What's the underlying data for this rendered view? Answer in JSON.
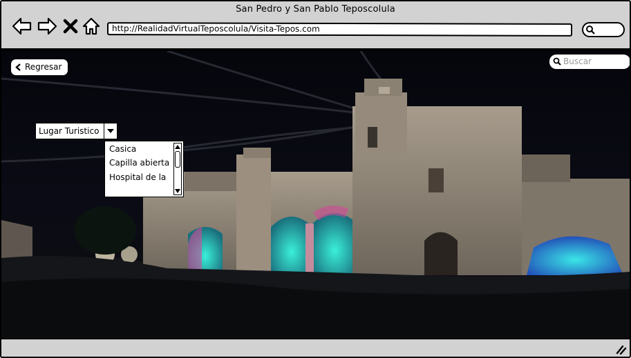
{
  "window": {
    "title": "San Pedro y San Pablo Teposcolula"
  },
  "toolbar": {
    "back_icon": "arrow-left-icon",
    "forward_icon": "arrow-right-icon",
    "stop_icon": "close-icon",
    "home_icon": "home-icon",
    "url": "http://RealidadVirtualTeposcolula/Visita-Tepos.com",
    "search_icon": "search-icon"
  },
  "page": {
    "back_button": {
      "label": "Regresar",
      "icon": "chevron-left-icon"
    },
    "search": {
      "placeholder": "Buscar",
      "icon": "search-icon"
    },
    "dropdown": {
      "selected": "Lugar Turistico",
      "icon": "chevron-down-icon",
      "options": [
        "Casica",
        "Capilla abierta",
        "Hospital de la"
      ]
    }
  },
  "colors": {
    "chrome": "#d2d2d2",
    "night_sky": "#05060c",
    "stone": "#8f8577",
    "light_cyan": "#29d9c6",
    "light_pink": "#d04a97"
  }
}
